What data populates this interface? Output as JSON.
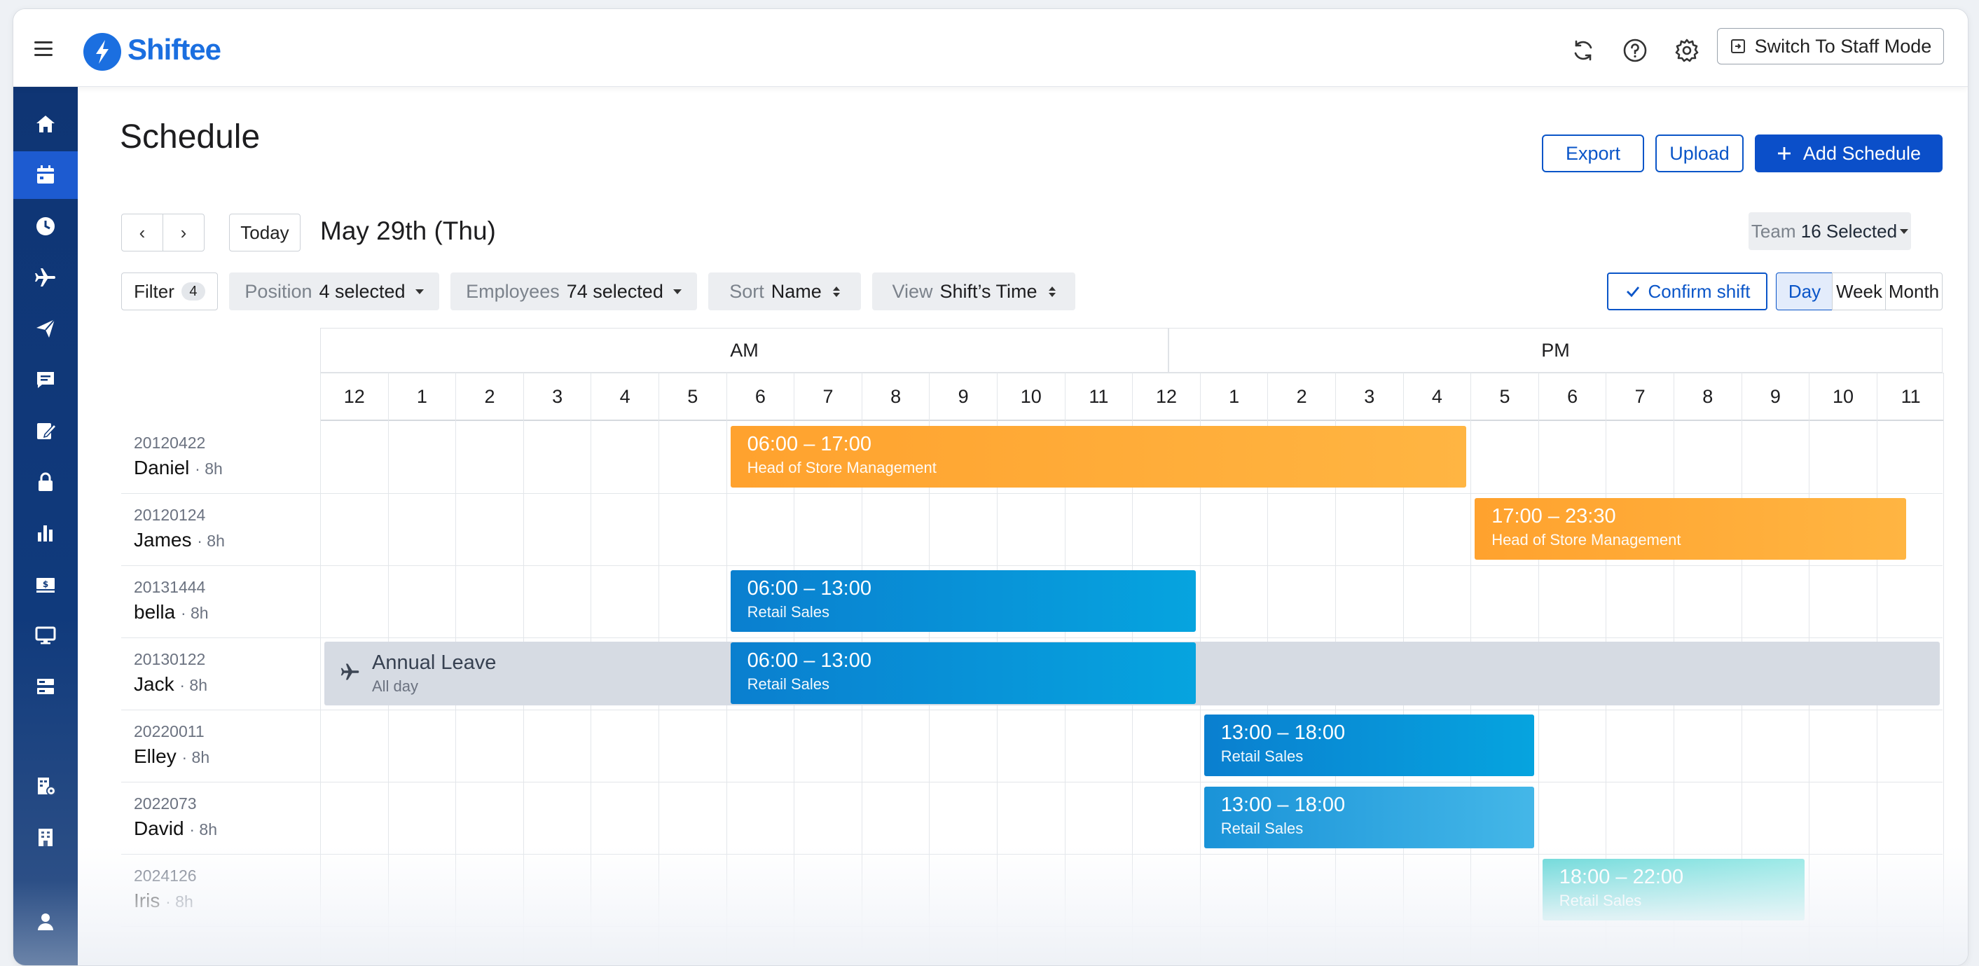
{
  "app": {
    "name": "Shiftee",
    "brand_color": "#1b6fe0",
    "nav_color": "#0f3574",
    "accent_color": "#0b4fc9"
  },
  "header": {
    "staff_mode_label": "Switch To Staff Mode"
  },
  "sidebar": {
    "items": [
      {
        "icon": "home-icon",
        "active": false
      },
      {
        "icon": "calendar-icon",
        "active": true
      },
      {
        "icon": "clock-icon",
        "active": false
      },
      {
        "icon": "airplane-icon",
        "active": false
      },
      {
        "icon": "paper-plane-icon",
        "active": false
      },
      {
        "icon": "message-icon",
        "active": false
      },
      {
        "icon": "edit-note-icon",
        "active": false
      },
      {
        "icon": "lock-icon",
        "active": false
      },
      {
        "icon": "bar-chart-icon",
        "active": false
      },
      {
        "icon": "payroll-icon",
        "active": false
      },
      {
        "icon": "monitor-icon",
        "active": false
      },
      {
        "icon": "server-icon",
        "active": false
      },
      {
        "icon": "building-settings-icon",
        "active": false
      },
      {
        "icon": "building-icon",
        "active": false
      },
      {
        "icon": "user-icon",
        "active": false
      }
    ]
  },
  "page": {
    "title": "Schedule",
    "export_label": "Export",
    "upload_label": "Upload",
    "add_schedule_label": "Add Schedule"
  },
  "date_nav": {
    "prev": "‹",
    "next": "›",
    "today_label": "Today",
    "date": "May 29th (Thu)"
  },
  "team": {
    "label": "Team",
    "value": "16 Selected"
  },
  "filters": {
    "filter_label": "Filter",
    "filter_count": "4",
    "position_label": "Position",
    "position_value": "4 selected",
    "employees_label": "Employees",
    "employees_value": "74 selected",
    "sort_label": "Sort",
    "sort_value": "Name",
    "view_label": "View",
    "view_value": "Shift’s Time"
  },
  "actions": {
    "confirm_label": "Confirm shift"
  },
  "view_modes": {
    "day": "Day",
    "week": "Week",
    "month": "Month",
    "active": "Day"
  },
  "timeline": {
    "periods": [
      "AM",
      "PM"
    ],
    "hours": [
      "12",
      "1",
      "2",
      "3",
      "4",
      "5",
      "6",
      "7",
      "8",
      "9",
      "10",
      "11",
      "12",
      "1",
      "2",
      "3",
      "4",
      "5",
      "6",
      "7",
      "8",
      "9",
      "10",
      "11"
    ]
  },
  "employees": [
    {
      "id": "20120422",
      "name": "Daniel",
      "hours": "· 8h"
    },
    {
      "id": "20120124",
      "name": "James",
      "hours": "· 8h"
    },
    {
      "id": "20131444",
      "name": "bella",
      "hours": "· 8h"
    },
    {
      "id": "20130122",
      "name": "Jack",
      "hours": "· 8h"
    },
    {
      "id": "20220011",
      "name": "Elley",
      "hours": "· 8h"
    },
    {
      "id": "2022073",
      "name": "David",
      "hours": "· 8h"
    },
    {
      "id": "2024126",
      "name": "Iris",
      "hours": "· 8h"
    }
  ],
  "shifts": [
    {
      "row": 0,
      "start": 6,
      "end": 17,
      "time": "06:00 – 17:00",
      "position": "Head of Store Management",
      "style": "orange"
    },
    {
      "row": 1,
      "start": 17,
      "end": 23.5,
      "time": "17:00 – 23:30",
      "position": "Head of Store Management",
      "style": "orange"
    },
    {
      "row": 2,
      "start": 6,
      "end": 13,
      "time": "06:00 – 13:00",
      "position": "Retail Sales",
      "style": "blue"
    },
    {
      "row": 3,
      "start": 6,
      "end": 13,
      "time": "06:00 – 13:00",
      "position": "Retail Sales",
      "style": "blue"
    },
    {
      "row": 4,
      "start": 13,
      "end": 18,
      "time": "13:00 – 18:00",
      "position": "Retail Sales",
      "style": "blue"
    },
    {
      "row": 5,
      "start": 13,
      "end": 18,
      "time": "13:00 – 18:00",
      "position": "Retail Sales",
      "style": "blue2"
    },
    {
      "row": 6,
      "start": 18,
      "end": 22,
      "time": "18:00 – 22:00",
      "position": "Retail Sales",
      "style": "teal"
    }
  ],
  "leave": {
    "row": 3,
    "title": "Annual Leave",
    "subtitle": "All day",
    "icon": "airplane-icon"
  }
}
